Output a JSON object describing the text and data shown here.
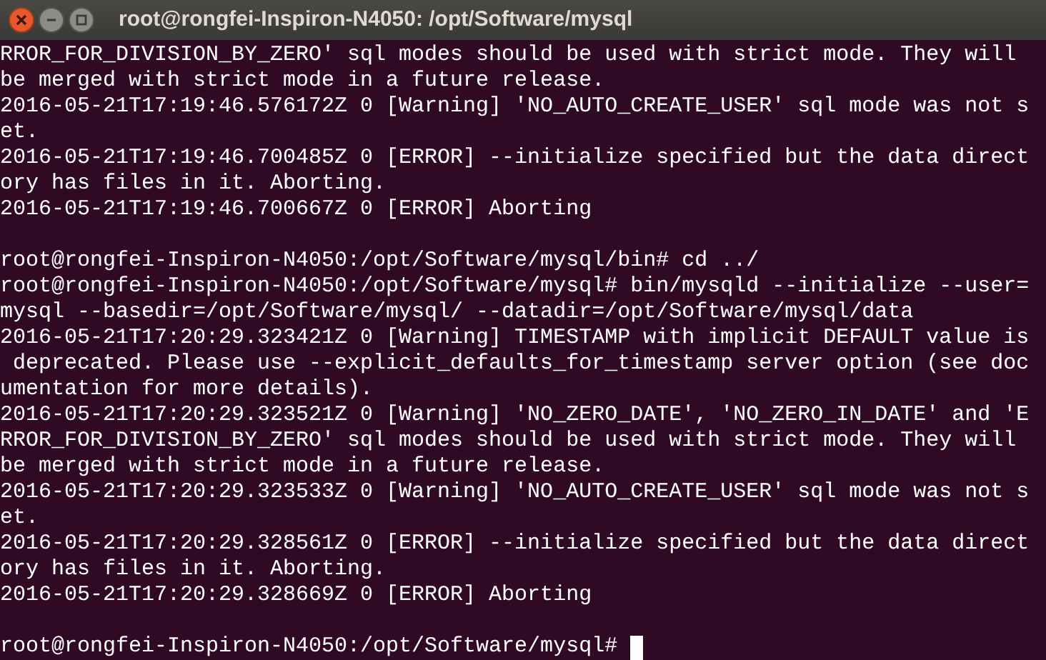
{
  "window": {
    "title": "root@rongfei-Inspiron-N4050: /opt/Software/mysql"
  },
  "terminal": {
    "lines": [
      {
        "kind": "output",
        "text": "RROR_FOR_DIVISION_BY_ZERO' sql modes should be used with strict mode. They will"
      },
      {
        "kind": "output",
        "text": "be merged with strict mode in a future release."
      },
      {
        "kind": "output",
        "text": "2016-05-21T17:19:46.576172Z 0 [Warning] 'NO_AUTO_CREATE_USER' sql mode was not s"
      },
      {
        "kind": "output",
        "text": "et."
      },
      {
        "kind": "output",
        "text": "2016-05-21T17:19:46.700485Z 0 [ERROR] --initialize specified but the data direct"
      },
      {
        "kind": "output",
        "text": "ory has files in it. Aborting."
      },
      {
        "kind": "output",
        "text": "2016-05-21T17:19:46.700667Z 0 [ERROR] Aborting"
      },
      {
        "kind": "blank"
      },
      {
        "kind": "output",
        "text": "root@rongfei-Inspiron-N4050:/opt/Software/mysql/bin# cd ../"
      },
      {
        "kind": "output",
        "text": "root@rongfei-Inspiron-N4050:/opt/Software/mysql# bin/mysqld --initialize --user="
      },
      {
        "kind": "output",
        "text": "mysql --basedir=/opt/Software/mysql/ --datadir=/opt/Software/mysql/data"
      },
      {
        "kind": "output",
        "text": "2016-05-21T17:20:29.323421Z 0 [Warning] TIMESTAMP with implicit DEFAULT value is"
      },
      {
        "kind": "output",
        "text": " deprecated. Please use --explicit_defaults_for_timestamp server option (see doc"
      },
      {
        "kind": "output",
        "text": "umentation for more details)."
      },
      {
        "kind": "output",
        "text": "2016-05-21T17:20:29.323521Z 0 [Warning] 'NO_ZERO_DATE', 'NO_ZERO_IN_DATE' and 'E"
      },
      {
        "kind": "output",
        "text": "RROR_FOR_DIVISION_BY_ZERO' sql modes should be used with strict mode. They will"
      },
      {
        "kind": "output",
        "text": "be merged with strict mode in a future release."
      },
      {
        "kind": "output",
        "text": "2016-05-21T17:20:29.323533Z 0 [Warning] 'NO_AUTO_CREATE_USER' sql mode was not s"
      },
      {
        "kind": "output",
        "text": "et."
      },
      {
        "kind": "output",
        "text": "2016-05-21T17:20:29.328561Z 0 [ERROR] --initialize specified but the data direct"
      },
      {
        "kind": "output",
        "text": "ory has files in it. Aborting."
      },
      {
        "kind": "output",
        "text": "2016-05-21T17:20:29.328669Z 0 [ERROR] Aborting"
      },
      {
        "kind": "blank"
      },
      {
        "kind": "prompt",
        "text": "root@rongfei-Inspiron-N4050:/opt/Software/mysql#"
      }
    ]
  }
}
